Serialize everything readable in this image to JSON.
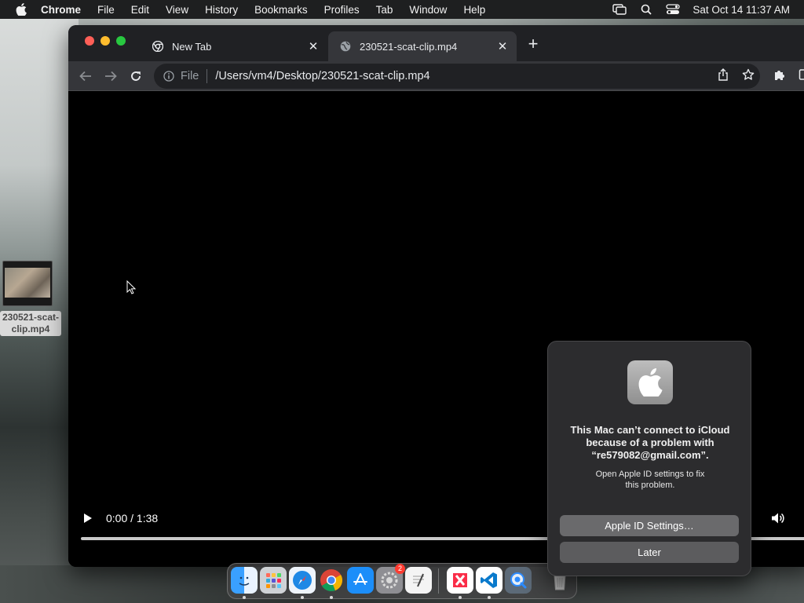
{
  "menubar": {
    "items": [
      "Chrome",
      "File",
      "Edit",
      "View",
      "History",
      "Bookmarks",
      "Profiles",
      "Tab",
      "Window",
      "Help"
    ],
    "clock": "Sat Oct 14  11:37 AM"
  },
  "desktop": {
    "file_label": "230521-scat-\nclip.mp4"
  },
  "browser": {
    "tabs": [
      {
        "title": "New Tab"
      },
      {
        "title": "230521-scat-clip.mp4"
      }
    ],
    "omnibox": {
      "scheme": "File",
      "url": "/Users/vm4/Desktop/230521-scat-clip.mp4"
    },
    "video": {
      "time": "0:00 / 1:38",
      "progress": 0.0
    }
  },
  "notification": {
    "headline": "This Mac can’t connect to iCloud\nbecause of a problem with\n“re579082@gmail.com”.",
    "body": "Open Apple ID settings to fix\nthis problem.",
    "primary_button": "Apple ID Settings…",
    "secondary_button": "Later"
  },
  "dock": {
    "apps": [
      "finder",
      "launchpad",
      "safari",
      "chrome",
      "app-store",
      "system-settings",
      "textedit",
      "news",
      "vscode",
      "quicktime",
      "trash"
    ],
    "settings_badge": "2"
  },
  "colors": {
    "accent_red": "#ff5f57",
    "accent_yellow": "#febc2e",
    "accent_green": "#28c840",
    "badge_red": "#ff3b30"
  }
}
